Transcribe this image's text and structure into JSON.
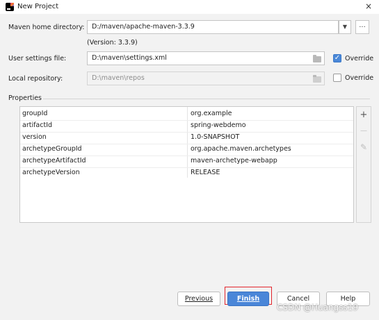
{
  "window": {
    "title": "New Project",
    "close_glyph": "×"
  },
  "form": {
    "maven_home_label": "Maven home directory:",
    "maven_home_value": "D:/maven/apache-maven-3.3.9",
    "version_note": "(Version: 3.3.9)",
    "user_settings_label": "User settings file:",
    "user_settings_value": "D:\\maven\\settings.xml",
    "user_settings_override": true,
    "local_repo_label": "Local repository:",
    "local_repo_value": "D:\\maven\\repos",
    "local_repo_override": false,
    "override_label": "Override",
    "browse_label": "...",
    "dropdown_glyph": "▼"
  },
  "properties": {
    "section_label": "Properties",
    "rows": [
      {
        "key": "groupId",
        "value": "org.example"
      },
      {
        "key": "artifactId",
        "value": "spring-webdemo"
      },
      {
        "key": "version",
        "value": "1.0-SNAPSHOT"
      },
      {
        "key": "archetypeGroupId",
        "value": "org.apache.maven.archetypes"
      },
      {
        "key": "archetypeArtifactId",
        "value": "maven-archetype-webapp"
      },
      {
        "key": "archetypeVersion",
        "value": "RELEASE"
      }
    ],
    "tools": {
      "add": "+",
      "remove": "—",
      "edit": "✎"
    }
  },
  "buttons": {
    "previous": "Previous",
    "finish": "Finish",
    "cancel": "Cancel",
    "help": "Help"
  },
  "watermark": "CSDN @Huangss19",
  "colors": {
    "accent": "#4a86d8",
    "highlight": "#e3242b"
  }
}
